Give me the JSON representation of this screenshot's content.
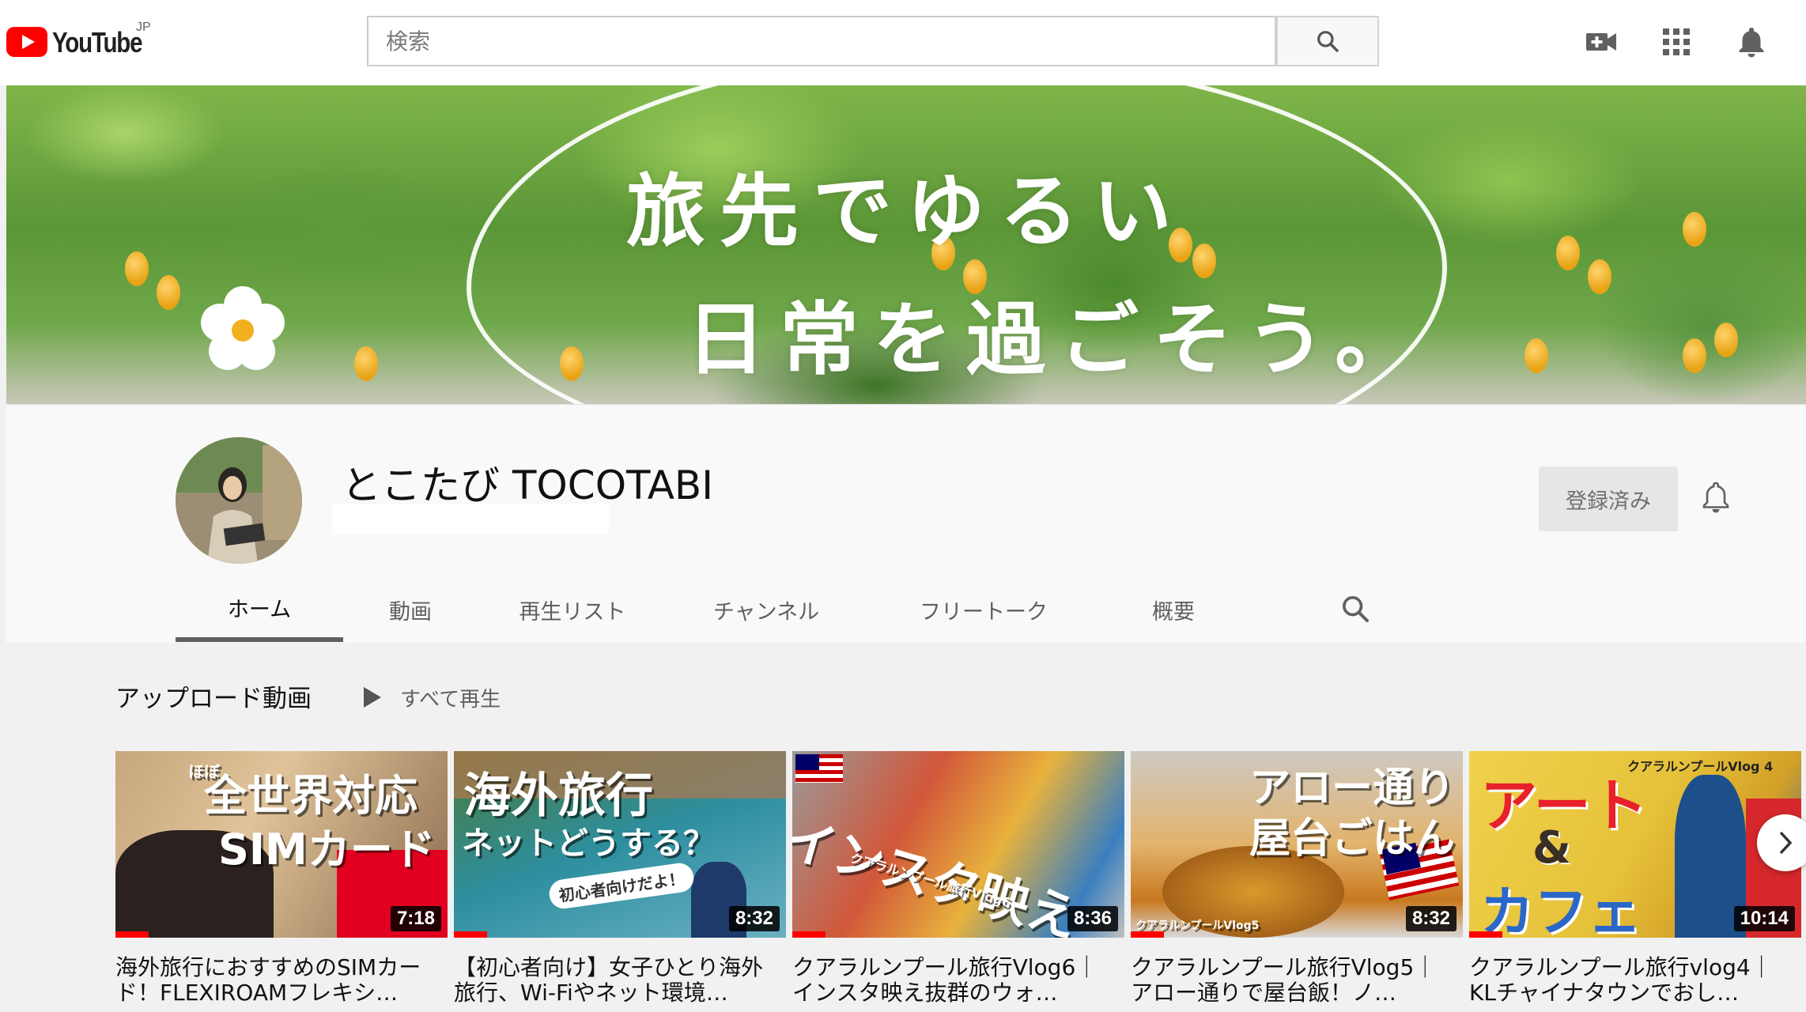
{
  "masthead": {
    "logo_text": "YouTube",
    "region": "JP",
    "search_placeholder": "検索",
    "icons": [
      "create-video-icon",
      "apps-grid-icon",
      "notifications-bell-icon"
    ]
  },
  "banner": {
    "line1": "旅先でゆるい",
    "line2": "日常を過ごそう。"
  },
  "channel": {
    "name": "とこたび TOCOTABI",
    "subscribe_label": "登録済み"
  },
  "tabs": [
    {
      "label": "ホーム",
      "active": true
    },
    {
      "label": "動画",
      "active": false
    },
    {
      "label": "再生リスト",
      "active": false
    },
    {
      "label": "チャンネル",
      "active": false
    },
    {
      "label": "フリートーク",
      "active": false
    },
    {
      "label": "概要",
      "active": false
    }
  ],
  "uploads": {
    "title": "アップロード動画",
    "play_all": "すべて再生",
    "videos": [
      {
        "title": "海外旅行におすすめのSIMカード！FLEXIROAMフレキシ…",
        "duration": "7:18",
        "thumb_lines": [
          "ほぼ",
          "全世界対応",
          "SIMカード"
        ],
        "progress": 0.1
      },
      {
        "title": "【初心者向け】女子ひとり海外旅行、Wi-Fiやネット環境…",
        "duration": "8:32",
        "thumb_lines": [
          "海外旅行",
          "ネットどうする？",
          "初心者向けだよ！"
        ],
        "progress": 0.1
      },
      {
        "title": "クアラルンプール旅行Vlog6｜インスタ映え抜群のウォ…",
        "duration": "8:36",
        "thumb_lines": [
          "インスタ映え",
          "クアラルンプール旅行Vlog6"
        ],
        "progress": 0.1
      },
      {
        "title": "クアラルンプール旅行Vlog5｜アロー通りで屋台飯！ノ…",
        "duration": "8:32",
        "thumb_lines": [
          "アロー通り",
          "屋台ごはん",
          "クアラルンプールVlog5"
        ],
        "progress": 0.1
      },
      {
        "title": "クアラルンプール旅行vlog4｜KLチャイナタウンでおし…",
        "duration": "10:14",
        "thumb_lines": [
          "クアラルンプールVlog 4",
          "アート",
          "&",
          "カフェ"
        ],
        "progress": 0.1
      }
    ]
  },
  "colors": {
    "brand_red": "#ff0000",
    "tab_underline": "#606060",
    "subscribed_bg": "#e6e6e6"
  }
}
